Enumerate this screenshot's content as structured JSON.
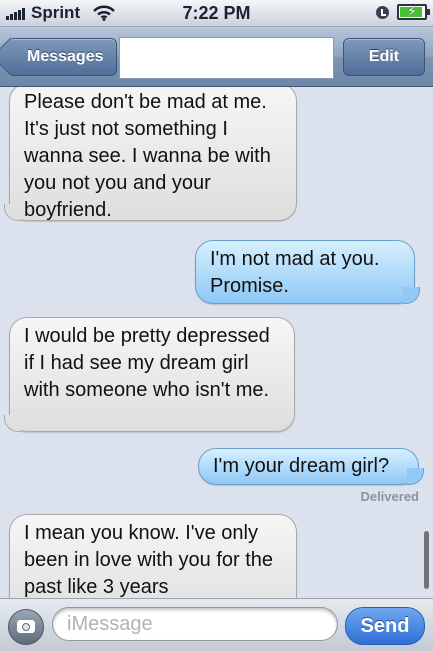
{
  "status_bar": {
    "carrier": "Sprint",
    "time": "7:22 PM",
    "battery_level": 0.85,
    "icons": [
      "signal-bars-icon",
      "wifi-icon",
      "rotation-lock-icon",
      "battery-charging-icon"
    ]
  },
  "nav": {
    "back_label": "Messages",
    "title": "",
    "edit_label": "Edit"
  },
  "messages": [
    {
      "direction": "incoming",
      "text": "Please don't be mad at me. It's just not something I wanna see. I wanna be with you not you and your boyfriend."
    },
    {
      "direction": "outgoing",
      "text": "I'm not mad at you. Promise."
    },
    {
      "direction": "incoming",
      "text": "I would be pretty depressed if I had see my dream girl with someone who isn't me."
    },
    {
      "direction": "outgoing",
      "text": "I'm your dream girl?"
    },
    {
      "direction": "incoming",
      "text": "I mean you know. I've only been in love with you for the past like 3 years"
    }
  ],
  "delivered_label": "Delivered",
  "input": {
    "placeholder": "iMessage",
    "value": "",
    "send_label": "Send"
  },
  "colors": {
    "incoming_bubble": "#e6e6e6",
    "outgoing_bubble": "#a9d7fa",
    "send_button": "#3f7fe0",
    "nav_bar": "#8ea3bf"
  }
}
